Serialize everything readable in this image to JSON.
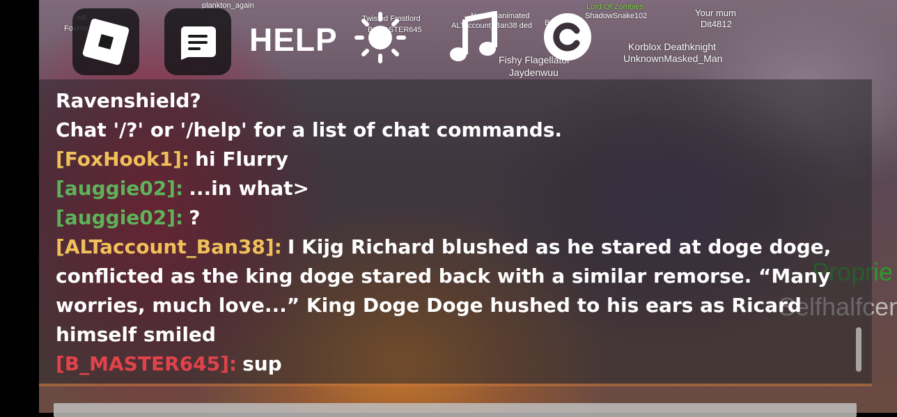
{
  "topbar": {
    "help_label": "HELP"
  },
  "nametags": [
    {
      "text": "plankton_again"
    },
    {
      "text": "m8"
    },
    {
      "text": "FoxHook1"
    },
    {
      "text": "Twisted Frostlord"
    },
    {
      "text": "B_MASTER645"
    },
    {
      "text": "New Reanimated"
    },
    {
      "text": "ALTaccount_Ban38 ded"
    },
    {
      "text": "Battlement"
    },
    {
      "text": "Lord Of Zombies"
    },
    {
      "text": "ShadowSnake102"
    },
    {
      "text": "Your mum"
    },
    {
      "text": "Dit4812"
    },
    {
      "text": "Korblox Deathknight"
    },
    {
      "text": "UnknownMasked_Man"
    },
    {
      "text": "Fishy Flagellator"
    },
    {
      "text": "Jaydenwuu"
    }
  ],
  "behind_panel": {
    "line1": "Proprie",
    "line2": "Selfhalfcen"
  },
  "chat": {
    "lines": [
      {
        "user": "",
        "text": "Ravenshield?"
      },
      {
        "user": "",
        "text": "Chat '/?' or '/help' for a list of chat commands."
      },
      {
        "user": "[FoxHook1]:",
        "text": "hi Flurry"
      },
      {
        "user": "[auggie02]:",
        "text": "...in what>"
      },
      {
        "user": "[auggie02]:",
        "text": "?"
      },
      {
        "user": "[ALTaccount_Ban38]:",
        "text": "I Kijg Richard blushed as he stared at doge doge, conflicted as the king doge stared back with a similar remorse. “Many worries, much love...” King Doge Doge hushed to his ears as Ricard himself smiled"
      },
      {
        "user": "[B_MASTER645]:",
        "text": "sup"
      }
    ],
    "user_colors": {
      "foxhook": "#f0c05a",
      "auggie": "#5fb25a",
      "altaccount": "#f0c05a",
      "bmaster": "#e0434a"
    }
  }
}
